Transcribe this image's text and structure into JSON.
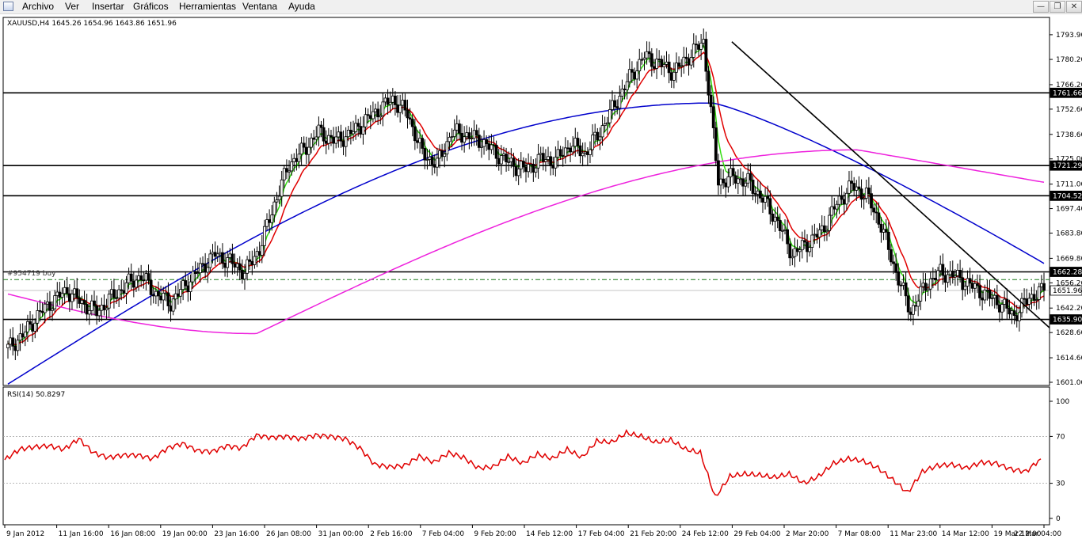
{
  "menu": {
    "items": [
      "Archivo",
      "Ver",
      "Insertar",
      "Gráficos",
      "Herramientas",
      "Ventana",
      "Ayuda"
    ],
    "window_buttons": [
      "minimize",
      "restore",
      "close"
    ]
  },
  "chart": {
    "symbol_info": "XAUUSD,H4  1645.26 1654.96 1643.86 1651.96",
    "order_label": "#954719 buy",
    "rsi_label": "RSI(14) 50.8297",
    "colors": {
      "candles": "#000000",
      "ma_fast": "#33dd11",
      "ma_mid": "#e00000",
      "ma_slow": "#0000cc",
      "ma_long": "#ee22dd",
      "rsi": "#e00000",
      "trendline": "#000000"
    }
  },
  "chart_data": [
    {
      "type": "candlestick",
      "title": "XAUUSD,H4",
      "ylim": [
        1601.0,
        1800.0
      ],
      "y_ticks": [
        "1793.90",
        "1780.20",
        "1766.20",
        "1752.60",
        "1738.60",
        "1725.00",
        "1711.00",
        "1697.40",
        "1683.80",
        "1669.80",
        "1656.20",
        "1642.20",
        "1628.60",
        "1614.60",
        "1601.00"
      ],
      "x_ticks": [
        "9 Jan 2012",
        "11 Jan 16:00",
        "16 Jan 08:00",
        "19 Jan 00:00",
        "23 Jan 16:00",
        "26 Jan 08:00",
        "31 Jan 00:00",
        "2 Feb 16:00",
        "7 Feb 04:00",
        "9 Feb 20:00",
        "14 Feb 12:00",
        "17 Feb 04:00",
        "21 Feb 20:00",
        "24 Feb 12:00",
        "29 Feb 04:00",
        "2 Mar 20:00",
        "7 Mar 08:00",
        "11 Mar 23:00",
        "14 Mar 12:00",
        "19 Mar 12:00",
        "22 Mar 04:00"
      ],
      "horizontal_levels": [
        {
          "label": "1761.66",
          "value": 1761.66
        },
        {
          "label": "1721.29",
          "value": 1721.29
        },
        {
          "label": "1704.52",
          "value": 1704.52
        },
        {
          "label": "1662.28",
          "value": 1662.28
        },
        {
          "label": "1651.96",
          "value": 1651.96
        },
        {
          "label": "1635.90",
          "value": 1635.9
        }
      ],
      "order_level": 1658.0,
      "last_price": 1651.96,
      "ohlc_anchor_closes": [
        1620,
        1627,
        1638,
        1646,
        1652,
        1645,
        1640,
        1648,
        1655,
        1660,
        1650,
        1645,
        1655,
        1664,
        1672,
        1668,
        1662,
        1675,
        1700,
        1722,
        1730,
        1740,
        1735,
        1738,
        1745,
        1752,
        1758,
        1750,
        1728,
        1722,
        1740,
        1738,
        1735,
        1728,
        1722,
        1719,
        1725,
        1724,
        1733,
        1728,
        1740,
        1755,
        1770,
        1782,
        1778,
        1773,
        1782,
        1790,
        1712,
        1715,
        1712,
        1703,
        1690,
        1672,
        1678,
        1685,
        1700,
        1710,
        1705,
        1688,
        1662,
        1640,
        1655,
        1662,
        1660,
        1655,
        1650,
        1645,
        1638,
        1648,
        1652
      ],
      "moving_averages": {
        "ma_long": {
          "start": 1650,
          "min": 1628,
          "peak": 1730,
          "end": 1712
        },
        "ma_slow": {
          "start": 1600,
          "peak": 1756,
          "end": 1667
        }
      },
      "trendline": {
        "from": [
          1790,
          "29 Feb 04:00"
        ],
        "to": [
          1633,
          "22 Mar 04:00"
        ]
      }
    },
    {
      "type": "line",
      "title": "RSI(14) 50.8297",
      "ylim": [
        0,
        100
      ],
      "y_ticks": [
        "100",
        "70",
        "30",
        "0"
      ],
      "levels": [
        70,
        30
      ],
      "values": [
        50,
        59,
        61,
        62,
        59,
        68,
        56,
        52,
        54,
        54,
        51,
        60,
        64,
        58,
        57,
        62,
        60,
        71,
        69,
        70,
        68,
        71,
        70,
        68,
        60,
        46,
        44,
        45,
        53,
        48,
        56,
        52,
        43,
        44,
        53,
        47,
        55,
        51,
        59,
        52,
        66,
        65,
        73,
        70,
        65,
        67,
        59,
        56,
        18,
        36,
        38,
        37,
        35,
        38,
        30,
        36,
        47,
        51,
        49,
        43,
        33,
        22,
        40,
        45,
        46,
        43,
        48,
        47,
        42,
        40,
        50.83
      ]
    }
  ]
}
